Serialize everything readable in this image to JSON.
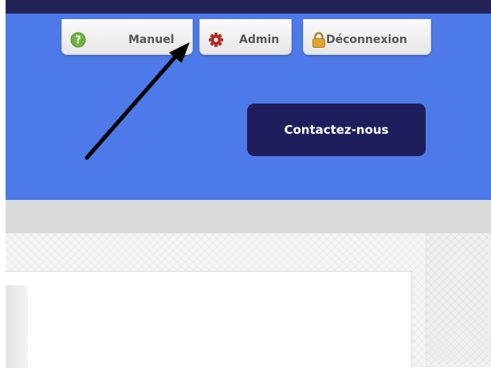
{
  "nav": {
    "manual_label": "Manuel",
    "admin_label": "Admin",
    "logout_label": "Déconnexion"
  },
  "header": {
    "contact_label": "Contactez-nous"
  },
  "icons": {
    "manual": "help-icon",
    "admin": "gear-icon",
    "logout": "lock-icon"
  },
  "colors": {
    "header_background": "#4d7ae8",
    "top_strip": "#23235a",
    "contact_button": "#1e1e5c",
    "help_icon": "#6fb43f",
    "gear_icon": "#b52a23",
    "lock_icon": "#e0a431"
  }
}
